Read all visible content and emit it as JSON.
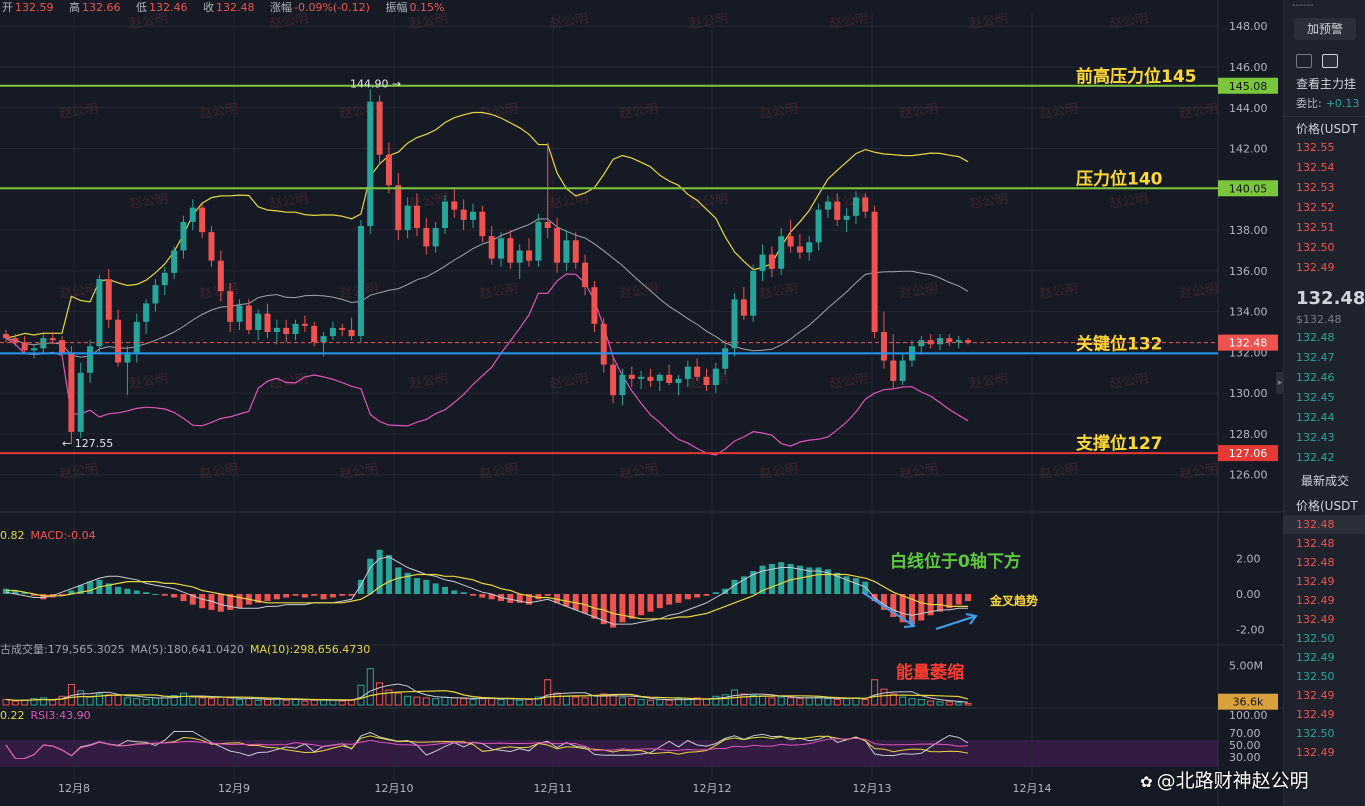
{
  "ohlc": {
    "open_label": "开",
    "open": "132.59",
    "high_label": "高",
    "high": "132.66",
    "low_label": "低",
    "low": "132.46",
    "close_label": "收",
    "close": "132.48",
    "change_label": "涨幅",
    "change": "-0.09%(-0.12)",
    "amplitude_label": "振幅",
    "amplitude": "0.15%"
  },
  "macd_legend": {
    "value_a": "0.82",
    "value_b": "MACD:-0.04"
  },
  "volume_legend": {
    "vol": "古成交量:179,565.3025",
    "ma5": "MA(5):180,641.0420",
    "ma10": "MA(10):298,656.4730"
  },
  "rsi_legend": {
    "value_a": "0.22",
    "value_b": "RSI3:43.90"
  },
  "colors": {
    "up": "#26a69a",
    "down": "#ef5350",
    "boll_upper": "#e6d63c",
    "boll_mid": "#9ea3ad",
    "boll_lower": "#e054b9",
    "resistance": "#7cc63c",
    "support": "#e53935",
    "key": "#2196f3",
    "annot": "#ffd835",
    "macd_annot": "#5ec93a",
    "vol_annot": "#ff3b30"
  },
  "chart_data": [
    {
      "type": "candlestick",
      "name": "",
      "x_tick_labels": [
        "12月8",
        "12月9",
        "12月10",
        "12月11",
        "12月12",
        "12月13",
        "12月14"
      ],
      "y_ticks": [
        148,
        146,
        144,
        142,
        140,
        138,
        136,
        134,
        132,
        130,
        128,
        126
      ],
      "ylim": [
        125.2,
        148.6
      ],
      "grid": true,
      "candles": [
        [
          132.9,
          133.1,
          132.5,
          132.7
        ],
        [
          132.7,
          132.9,
          132.3,
          132.5
        ],
        [
          132.5,
          132.8,
          131.9,
          132.1
        ],
        [
          132.1,
          132.4,
          131.7,
          132.2
        ],
        [
          132.2,
          132.9,
          131.9,
          132.7
        ],
        [
          132.7,
          133.0,
          132.4,
          132.6
        ],
        [
          132.6,
          132.8,
          131.8,
          132.0
        ],
        [
          132.0,
          132.3,
          127.5,
          128.1
        ],
        [
          128.1,
          131.5,
          127.8,
          131.0
        ],
        [
          131.0,
          132.6,
          130.5,
          132.3
        ],
        [
          132.3,
          135.8,
          132.0,
          135.6
        ],
        [
          135.6,
          136.1,
          133.2,
          133.6
        ],
        [
          133.6,
          134.1,
          131.3,
          131.5
        ],
        [
          131.5,
          132.3,
          129.9,
          132.0
        ],
        [
          132.0,
          133.9,
          131.5,
          133.5
        ],
        [
          133.5,
          134.6,
          132.9,
          134.4
        ],
        [
          134.4,
          135.6,
          134.0,
          135.3
        ],
        [
          135.3,
          136.2,
          134.8,
          135.9
        ],
        [
          135.9,
          137.2,
          135.6,
          137.0
        ],
        [
          137.0,
          138.7,
          136.6,
          138.4
        ],
        [
          138.4,
          139.5,
          138.0,
          139.1
        ],
        [
          139.1,
          139.3,
          137.6,
          137.9
        ],
        [
          137.9,
          138.2,
          136.2,
          136.5
        ],
        [
          136.5,
          137.0,
          134.5,
          135.0
        ],
        [
          135.0,
          135.4,
          133.0,
          133.5
        ],
        [
          133.5,
          134.6,
          133.1,
          134.3
        ],
        [
          134.3,
          134.6,
          132.9,
          133.1
        ],
        [
          133.1,
          134.1,
          132.6,
          133.9
        ],
        [
          133.9,
          134.4,
          132.7,
          133.0
        ],
        [
          133.0,
          133.6,
          132.4,
          133.2
        ],
        [
          133.2,
          133.6,
          132.5,
          132.9
        ],
        [
          132.9,
          133.6,
          132.6,
          133.4
        ],
        [
          133.4,
          133.8,
          133.0,
          133.3
        ],
        [
          133.3,
          133.5,
          132.3,
          132.5
        ],
        [
          132.5,
          133.0,
          131.8,
          132.8
        ],
        [
          132.8,
          133.5,
          132.6,
          133.2
        ],
        [
          133.2,
          133.4,
          132.8,
          133.1
        ],
        [
          133.1,
          133.7,
          132.6,
          132.8
        ],
        [
          132.8,
          138.5,
          132.5,
          138.2
        ],
        [
          138.2,
          144.9,
          137.8,
          144.3
        ],
        [
          144.3,
          144.6,
          141.2,
          141.7
        ],
        [
          141.7,
          142.3,
          139.8,
          140.2
        ],
        [
          140.2,
          140.8,
          137.5,
          138.0
        ],
        [
          138.0,
          139.6,
          137.6,
          139.2
        ],
        [
          139.2,
          139.8,
          137.7,
          138.1
        ],
        [
          138.1,
          138.6,
          136.8,
          137.2
        ],
        [
          137.2,
          138.4,
          136.9,
          138.1
        ],
        [
          138.1,
          139.7,
          137.8,
          139.4
        ],
        [
          139.4,
          140.1,
          138.6,
          139.0
        ],
        [
          139.0,
          139.5,
          138.0,
          138.5
        ],
        [
          138.5,
          139.3,
          138.1,
          138.9
        ],
        [
          138.9,
          139.2,
          137.4,
          137.7
        ],
        [
          137.7,
          138.2,
          136.3,
          136.6
        ],
        [
          136.6,
          137.9,
          136.2,
          137.6
        ],
        [
          137.6,
          138.0,
          136.1,
          136.4
        ],
        [
          136.4,
          137.3,
          135.6,
          137.0
        ],
        [
          137.0,
          137.6,
          136.2,
          136.5
        ],
        [
          136.5,
          138.8,
          136.2,
          138.4
        ],
        [
          138.4,
          142.3,
          137.6,
          138.1
        ],
        [
          138.1,
          138.6,
          135.9,
          136.4
        ],
        [
          136.4,
          138.0,
          136.0,
          137.5
        ],
        [
          137.5,
          137.9,
          136.1,
          136.4
        ],
        [
          136.4,
          136.8,
          134.8,
          135.2
        ],
        [
          135.2,
          135.5,
          133.0,
          133.4
        ],
        [
          133.4,
          133.7,
          131.0,
          131.4
        ],
        [
          131.4,
          131.8,
          129.5,
          129.9
        ],
        [
          129.9,
          131.2,
          129.4,
          130.9
        ],
        [
          130.9,
          131.3,
          130.3,
          130.7
        ],
        [
          130.7,
          131.1,
          130.2,
          130.8
        ],
        [
          130.8,
          131.2,
          130.3,
          130.6
        ],
        [
          130.6,
          131.0,
          130.1,
          130.9
        ],
        [
          130.9,
          131.4,
          130.4,
          130.5
        ],
        [
          130.5,
          130.9,
          129.9,
          130.7
        ],
        [
          130.7,
          131.6,
          130.3,
          131.3
        ],
        [
          131.3,
          131.7,
          130.6,
          130.8
        ],
        [
          130.8,
          131.2,
          130.1,
          130.4
        ],
        [
          130.4,
          131.5,
          130.0,
          131.2
        ],
        [
          131.2,
          132.6,
          130.9,
          132.2
        ],
        [
          132.2,
          134.9,
          131.8,
          134.6
        ],
        [
          134.6,
          135.2,
          133.6,
          133.8
        ],
        [
          133.8,
          136.3,
          133.5,
          136.0
        ],
        [
          136.0,
          137.3,
          135.5,
          136.8
        ],
        [
          136.8,
          137.2,
          135.7,
          136.1
        ],
        [
          136.1,
          138.1,
          135.8,
          137.7
        ],
        [
          137.7,
          138.5,
          136.9,
          137.2
        ],
        [
          137.2,
          137.8,
          136.6,
          136.9
        ],
        [
          136.9,
          137.7,
          136.5,
          137.4
        ],
        [
          137.4,
          139.3,
          137.0,
          139.0
        ],
        [
          139.0,
          139.7,
          138.6,
          139.4
        ],
        [
          139.4,
          139.8,
          138.2,
          138.5
        ],
        [
          138.5,
          139.1,
          137.9,
          138.7
        ],
        [
          138.7,
          139.9,
          138.3,
          139.6
        ],
        [
          139.6,
          139.8,
          138.6,
          138.9
        ],
        [
          138.9,
          139.2,
          132.7,
          133.0
        ],
        [
          133.0,
          134.0,
          131.2,
          131.6
        ],
        [
          131.6,
          132.9,
          130.2,
          130.6
        ],
        [
          130.6,
          131.9,
          130.4,
          131.6
        ],
        [
          131.6,
          132.6,
          131.3,
          132.3
        ],
        [
          132.3,
          132.8,
          131.9,
          132.6
        ],
        [
          132.6,
          132.9,
          132.2,
          132.4
        ],
        [
          132.4,
          132.9,
          132.1,
          132.7
        ],
        [
          132.7,
          132.9,
          132.3,
          132.5
        ],
        [
          132.5,
          132.8,
          132.2,
          132.6
        ],
        [
          132.6,
          132.7,
          132.4,
          132.48
        ]
      ],
      "bollinger": {
        "upper_color": "yellow",
        "mid_color": "grey",
        "lower_color": "magenta"
      },
      "horizontal_levels": [
        {
          "value": 145.08,
          "label": "前高压力位145",
          "tag": "145.08",
          "color": "resistance"
        },
        {
          "value": 140.05,
          "label": "压力位140",
          "tag": "140.05",
          "color": "resistance"
        },
        {
          "value": 131.95,
          "label": "关键位132",
          "tag": "132.48",
          "color": "key"
        },
        {
          "value": 127.06,
          "label": "支撑位127",
          "tag": "127.06",
          "color": "support"
        }
      ],
      "current_price": 132.48,
      "extreme_labels": [
        {
          "text": "144.90 →",
          "value": 144.9
        },
        {
          "text": "← 127.55",
          "value": 127.55
        }
      ]
    },
    {
      "type": "bar",
      "name": "",
      "y_ticks": [
        "2.00",
        "0.00",
        "-2.00"
      ],
      "ylim": [
        -2.6,
        2.6
      ],
      "histogram": [
        0.3,
        0.2,
        0.1,
        -0.1,
        -0.3,
        -0.2,
        -0.1,
        0.2,
        0.5,
        0.7,
        0.8,
        0.6,
        0.4,
        0.3,
        0.2,
        0.1,
        0.0,
        -0.1,
        -0.2,
        -0.4,
        -0.6,
        -0.8,
        -0.9,
        -1.0,
        -0.9,
        -0.8,
        -0.6,
        -0.5,
        -0.4,
        -0.3,
        -0.2,
        -0.1,
        -0.2,
        -0.1,
        -0.3,
        -0.2,
        -0.1,
        -0.1,
        0.8,
        2.0,
        2.5,
        2.2,
        1.5,
        1.2,
        0.9,
        0.8,
        0.6,
        0.4,
        0.2,
        0.1,
        -0.1,
        -0.2,
        -0.3,
        -0.4,
        -0.5,
        -0.5,
        -0.6,
        -0.3,
        -0.1,
        -0.5,
        -0.7,
        -0.9,
        -1.1,
        -1.4,
        -1.7,
        -1.9,
        -1.6,
        -1.4,
        -1.2,
        -1.0,
        -0.8,
        -0.6,
        -0.5,
        -0.3,
        -0.2,
        -0.1,
        0.1,
        0.3,
        0.8,
        1.0,
        1.3,
        1.6,
        1.7,
        1.8,
        1.7,
        1.6,
        1.5,
        1.5,
        1.4,
        1.2,
        1.0,
        0.9,
        0.7,
        -0.4,
        -0.9,
        -1.3,
        -1.6,
        -1.7,
        -1.5,
        -1.2,
        -1.0,
        -0.8,
        -0.6,
        -0.4
      ],
      "dif": [
        0.1,
        0.0,
        -0.1,
        -0.2,
        -0.2,
        -0.1,
        0.1,
        0.3,
        0.5,
        0.7,
        0.9,
        1.0,
        1.0,
        0.9,
        0.8,
        0.6,
        0.5,
        0.4,
        0.3,
        0.1,
        -0.1,
        -0.3,
        -0.4,
        -0.6,
        -0.7,
        -0.8,
        -0.8,
        -0.8,
        -0.7,
        -0.7,
        -0.6,
        -0.6,
        -0.6,
        -0.5,
        -0.5,
        -0.5,
        -0.4,
        -0.3,
        0.5,
        1.5,
        2.0,
        2.1,
        1.8,
        1.5,
        1.3,
        1.1,
        1.0,
        0.8,
        0.7,
        0.5,
        0.3,
        0.1,
        0.0,
        -0.2,
        -0.3,
        -0.4,
        -0.5,
        -0.4,
        -0.3,
        -0.5,
        -0.7,
        -0.9,
        -1.1,
        -1.3,
        -1.5,
        -1.7,
        -1.7,
        -1.7,
        -1.6,
        -1.5,
        -1.4,
        -1.2,
        -1.1,
        -0.9,
        -0.7,
        -0.5,
        -0.2,
        0.1,
        0.5,
        0.8,
        1.1,
        1.3,
        1.4,
        1.5,
        1.5,
        1.4,
        1.3,
        1.3,
        1.2,
        1.0,
        0.8,
        0.6,
        0.4,
        -0.2,
        -0.6,
        -0.9,
        -1.1,
        -1.2,
        -1.1,
        -1.0,
        -0.9,
        -0.9,
        -0.8,
        -0.8
      ],
      "dea": [
        0.2,
        0.2,
        0.1,
        0.0,
        -0.1,
        -0.1,
        -0.1,
        0.0,
        0.1,
        0.2,
        0.4,
        0.5,
        0.6,
        0.7,
        0.7,
        0.7,
        0.7,
        0.6,
        0.6,
        0.5,
        0.4,
        0.2,
        0.1,
        0.0,
        -0.1,
        -0.2,
        -0.3,
        -0.4,
        -0.5,
        -0.5,
        -0.5,
        -0.5,
        -0.5,
        -0.5,
        -0.5,
        -0.5,
        -0.5,
        -0.4,
        -0.3,
        0.0,
        0.4,
        0.7,
        0.9,
        1.0,
        1.1,
        1.1,
        1.1,
        1.0,
        1.0,
        0.9,
        0.8,
        0.6,
        0.5,
        0.3,
        0.2,
        0.0,
        -0.1,
        -0.2,
        -0.2,
        -0.3,
        -0.4,
        -0.5,
        -0.6,
        -0.8,
        -0.9,
        -1.1,
        -1.2,
        -1.3,
        -1.4,
        -1.4,
        -1.4,
        -1.4,
        -1.3,
        -1.3,
        -1.2,
        -1.1,
        -0.9,
        -0.7,
        -0.5,
        -0.3,
        -0.1,
        0.2,
        0.4,
        0.6,
        0.8,
        0.9,
        1.0,
        1.1,
        1.1,
        1.1,
        1.1,
        1.0,
        0.9,
        0.7,
        0.4,
        0.1,
        -0.1,
        -0.3,
        -0.5,
        -0.6,
        -0.6,
        -0.7,
        -0.7,
        -0.7
      ],
      "annotations": [
        {
          "text": "白线位于0轴下方",
          "color": "macd_annot"
        },
        {
          "text": "金叉趋势",
          "color": "annot"
        }
      ]
    },
    {
      "type": "bar",
      "name": "",
      "y_ticks": [
        "5.00M"
      ],
      "tag": "36.6k",
      "ylim": [
        0,
        6.2
      ],
      "values": [
        0.7,
        0.5,
        0.6,
        0.8,
        0.9,
        0.6,
        1.1,
        2.6,
        1.8,
        1.0,
        1.4,
        1.3,
        1.2,
        0.9,
        0.8,
        0.7,
        0.9,
        1.1,
        1.2,
        1.5,
        1.0,
        0.9,
        0.8,
        1.0,
        0.9,
        0.7,
        0.8,
        0.6,
        0.7,
        0.9,
        0.6,
        0.7,
        0.5,
        0.6,
        0.7,
        0.6,
        0.5,
        0.6,
        2.5,
        4.6,
        2.8,
        1.9,
        1.5,
        1.1,
        1.0,
        0.9,
        0.8,
        1.0,
        0.9,
        0.8,
        0.7,
        0.8,
        0.9,
        0.7,
        0.8,
        0.6,
        0.7,
        1.0,
        3.2,
        1.5,
        1.1,
        1.0,
        0.9,
        1.2,
        1.4,
        1.3,
        0.9,
        0.8,
        0.7,
        0.6,
        0.7,
        0.6,
        0.8,
        0.7,
        0.9,
        0.8,
        1.1,
        1.3,
        1.9,
        1.4,
        1.2,
        1.1,
        0.9,
        1.0,
        0.9,
        0.8,
        0.9,
        1.0,
        0.8,
        0.7,
        0.8,
        0.9,
        0.7,
        3.2,
        2.0,
        1.4,
        1.0,
        0.8,
        0.7,
        0.5,
        0.4,
        0.4,
        0.3,
        0.2
      ],
      "annotations": [
        {
          "text": "能量萎缩",
          "color": "vol_annot"
        }
      ]
    },
    {
      "type": "line",
      "name": "",
      "y_ticks": [
        "100.00",
        "70.00",
        "50.00",
        "30.00"
      ],
      "ylim": [
        0,
        100
      ]
    }
  ],
  "side_panel": {
    "dashes": "------",
    "alert_button": "加预警",
    "view_depth": "查看主力挂",
    "ratio_label": "委比:",
    "ratio_value": "+0.13",
    "price_header": "价格(USDT",
    "asks": [
      "132.55",
      "132.54",
      "132.53",
      "132.52",
      "132.51",
      "132.50",
      "132.49"
    ],
    "last_price": "132.48",
    "last_price_sub": "$132.48",
    "bids": [
      "132.48",
      "132.47",
      "132.46",
      "132.45",
      "132.44",
      "132.43",
      "132.42"
    ],
    "trades_title": "最新成交",
    "trades_header": "价格(USDT",
    "trades": [
      {
        "p": "132.48",
        "side": "ask"
      },
      {
        "p": "132.48",
        "side": "ask"
      },
      {
        "p": "132.48",
        "side": "ask"
      },
      {
        "p": "132.49",
        "side": "ask"
      },
      {
        "p": "132.49",
        "side": "ask"
      },
      {
        "p": "132.49",
        "side": "ask"
      },
      {
        "p": "132.50",
        "side": "bid"
      },
      {
        "p": "132.49",
        "side": "bid"
      },
      {
        "p": "132.50",
        "side": "bid"
      },
      {
        "p": "132.49",
        "side": "ask"
      },
      {
        "p": "132.49",
        "side": "ask"
      },
      {
        "p": "132.50",
        "side": "bid"
      },
      {
        "p": "132.49",
        "side": "ask"
      }
    ]
  },
  "watermark": "赵公明",
  "credit": "@北路财神赵公明"
}
